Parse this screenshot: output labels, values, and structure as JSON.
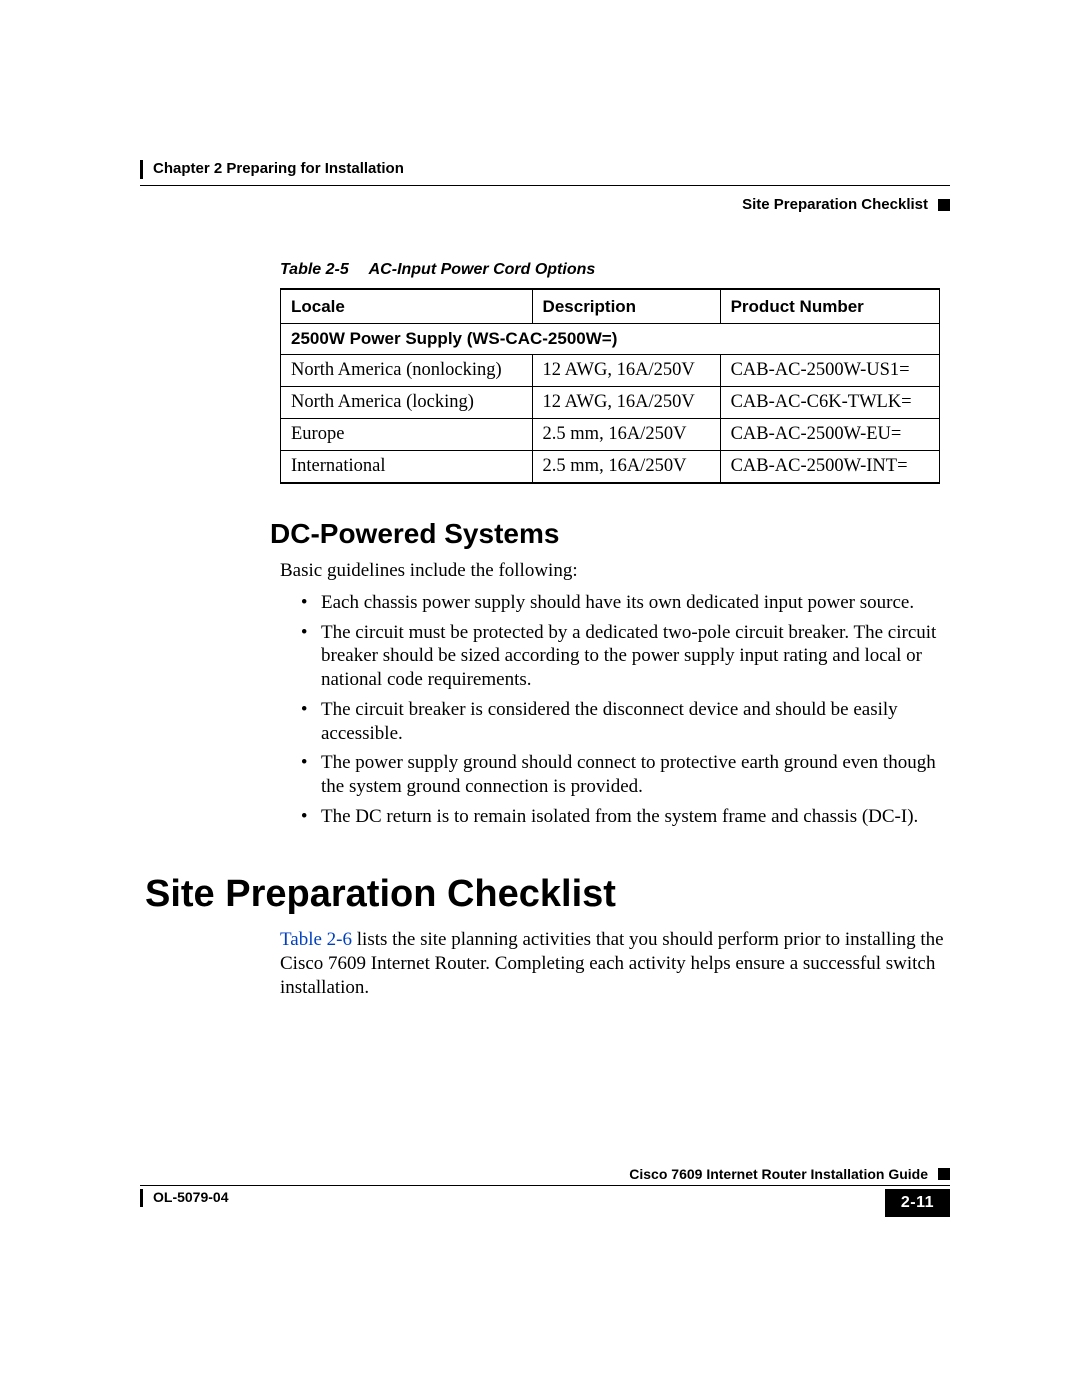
{
  "header": {
    "chapter_line": "Chapter 2    Preparing for Installation",
    "section_line": "Site Preparation Checklist"
  },
  "table": {
    "caption_num": "Table 2-5",
    "caption_title": "AC-Input Power Cord Options",
    "columns": [
      "Locale",
      "Description",
      "Product Number"
    ],
    "subhead": "2500W Power Supply (WS-CAC-2500W=)",
    "rows": [
      {
        "locale": "North America (nonlocking)",
        "desc": "12 AWG, 16A/250V",
        "pn": "CAB-AC-2500W-US1="
      },
      {
        "locale": "North America (locking)",
        "desc": "12 AWG, 16A/250V",
        "pn": "CAB-AC-C6K-TWLK="
      },
      {
        "locale": "Europe",
        "desc": "2.5 mm, 16A/250V",
        "pn": "CAB-AC-2500W-EU="
      },
      {
        "locale": "International",
        "desc": "2.5 mm, 16A/250V",
        "pn": "CAB-AC-2500W-INT="
      }
    ]
  },
  "dc": {
    "heading": "DC-Powered Systems",
    "intro": "Basic guidelines include the following:",
    "bullets": [
      "Each chassis power supply should have its own dedicated input power source.",
      "The circuit must be protected by a dedicated two-pole circuit breaker. The circuit breaker should be sized according to the power supply input rating and local or national code requirements.",
      "The circuit breaker is considered the disconnect device and should be easily accessible.",
      "The power supply ground should connect to protective earth ground even though the system ground connection is provided.",
      "The DC return is to remain isolated from the system frame and chassis (DC-I)."
    ]
  },
  "site": {
    "heading": "Site Preparation Checklist",
    "xref": "Table 2-6",
    "para_rest": " lists the site planning activities that you should perform prior to installing the Cisco 7609 Internet Router. Completing each activity helps ensure a successful switch installation."
  },
  "footer": {
    "guide_title": "Cisco 7609 Internet Router Installation Guide",
    "doc_number": "OL-5079-04",
    "page": "2-11"
  }
}
